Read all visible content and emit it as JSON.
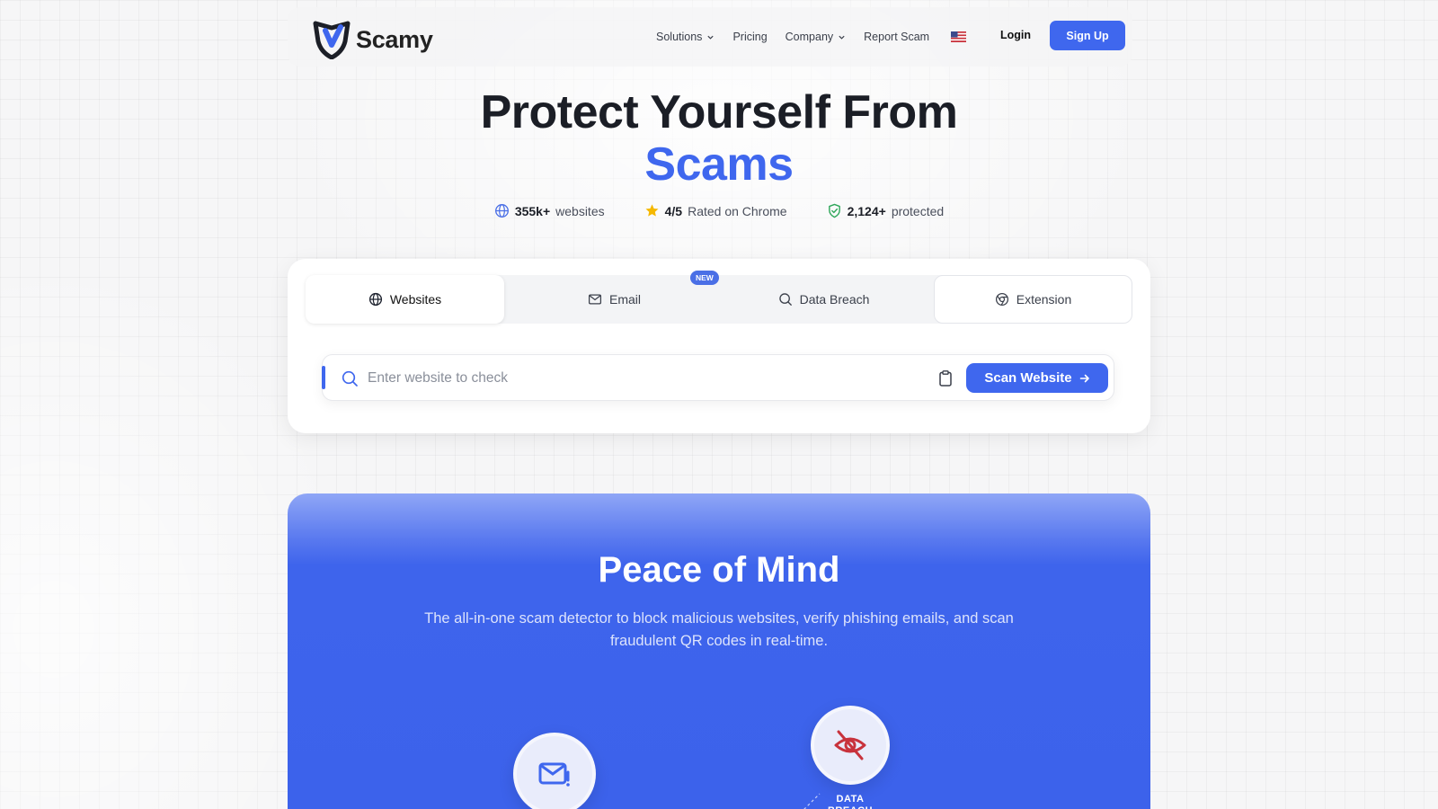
{
  "brand": {
    "name": "Scamy",
    "accent": "#3f67ee"
  },
  "nav": {
    "items": [
      {
        "label": "Solutions",
        "dropdown": true
      },
      {
        "label": "Pricing",
        "dropdown": false
      },
      {
        "label": "Company",
        "dropdown": true
      },
      {
        "label": "Report Scam",
        "dropdown": false
      }
    ],
    "flag": "us-flag-icon",
    "login": "Login",
    "signup": "Sign Up"
  },
  "hero": {
    "title_line1": "Protect Yourself From",
    "title_line2": "Scams"
  },
  "stats": [
    {
      "icon": "globe-icon",
      "value": "355k+",
      "label": "websites"
    },
    {
      "icon": "star-icon",
      "value": "4/5",
      "label": "Rated on Chrome"
    },
    {
      "icon": "shield-check-icon",
      "value": "2,124+",
      "label": "protected"
    }
  ],
  "tabs": [
    {
      "icon": "globe-icon",
      "label": "Websites",
      "active": true
    },
    {
      "icon": "mail-icon",
      "label": "Email",
      "badge": "NEW"
    },
    {
      "icon": "search-icon",
      "label": "Data Breach"
    },
    {
      "icon": "chrome-icon",
      "label": "Extension"
    }
  ],
  "search": {
    "placeholder": "Enter website to check",
    "value": "",
    "button": "Scan Website"
  },
  "section": {
    "title_bold": "Peace",
    "title_rest": " of Mind",
    "subtitle": "The all-in-one scam detector to block malicious websites, verify phishing emails, and scan fraudulent QR codes in real-time.",
    "breach_label": "DATA BREACH"
  }
}
